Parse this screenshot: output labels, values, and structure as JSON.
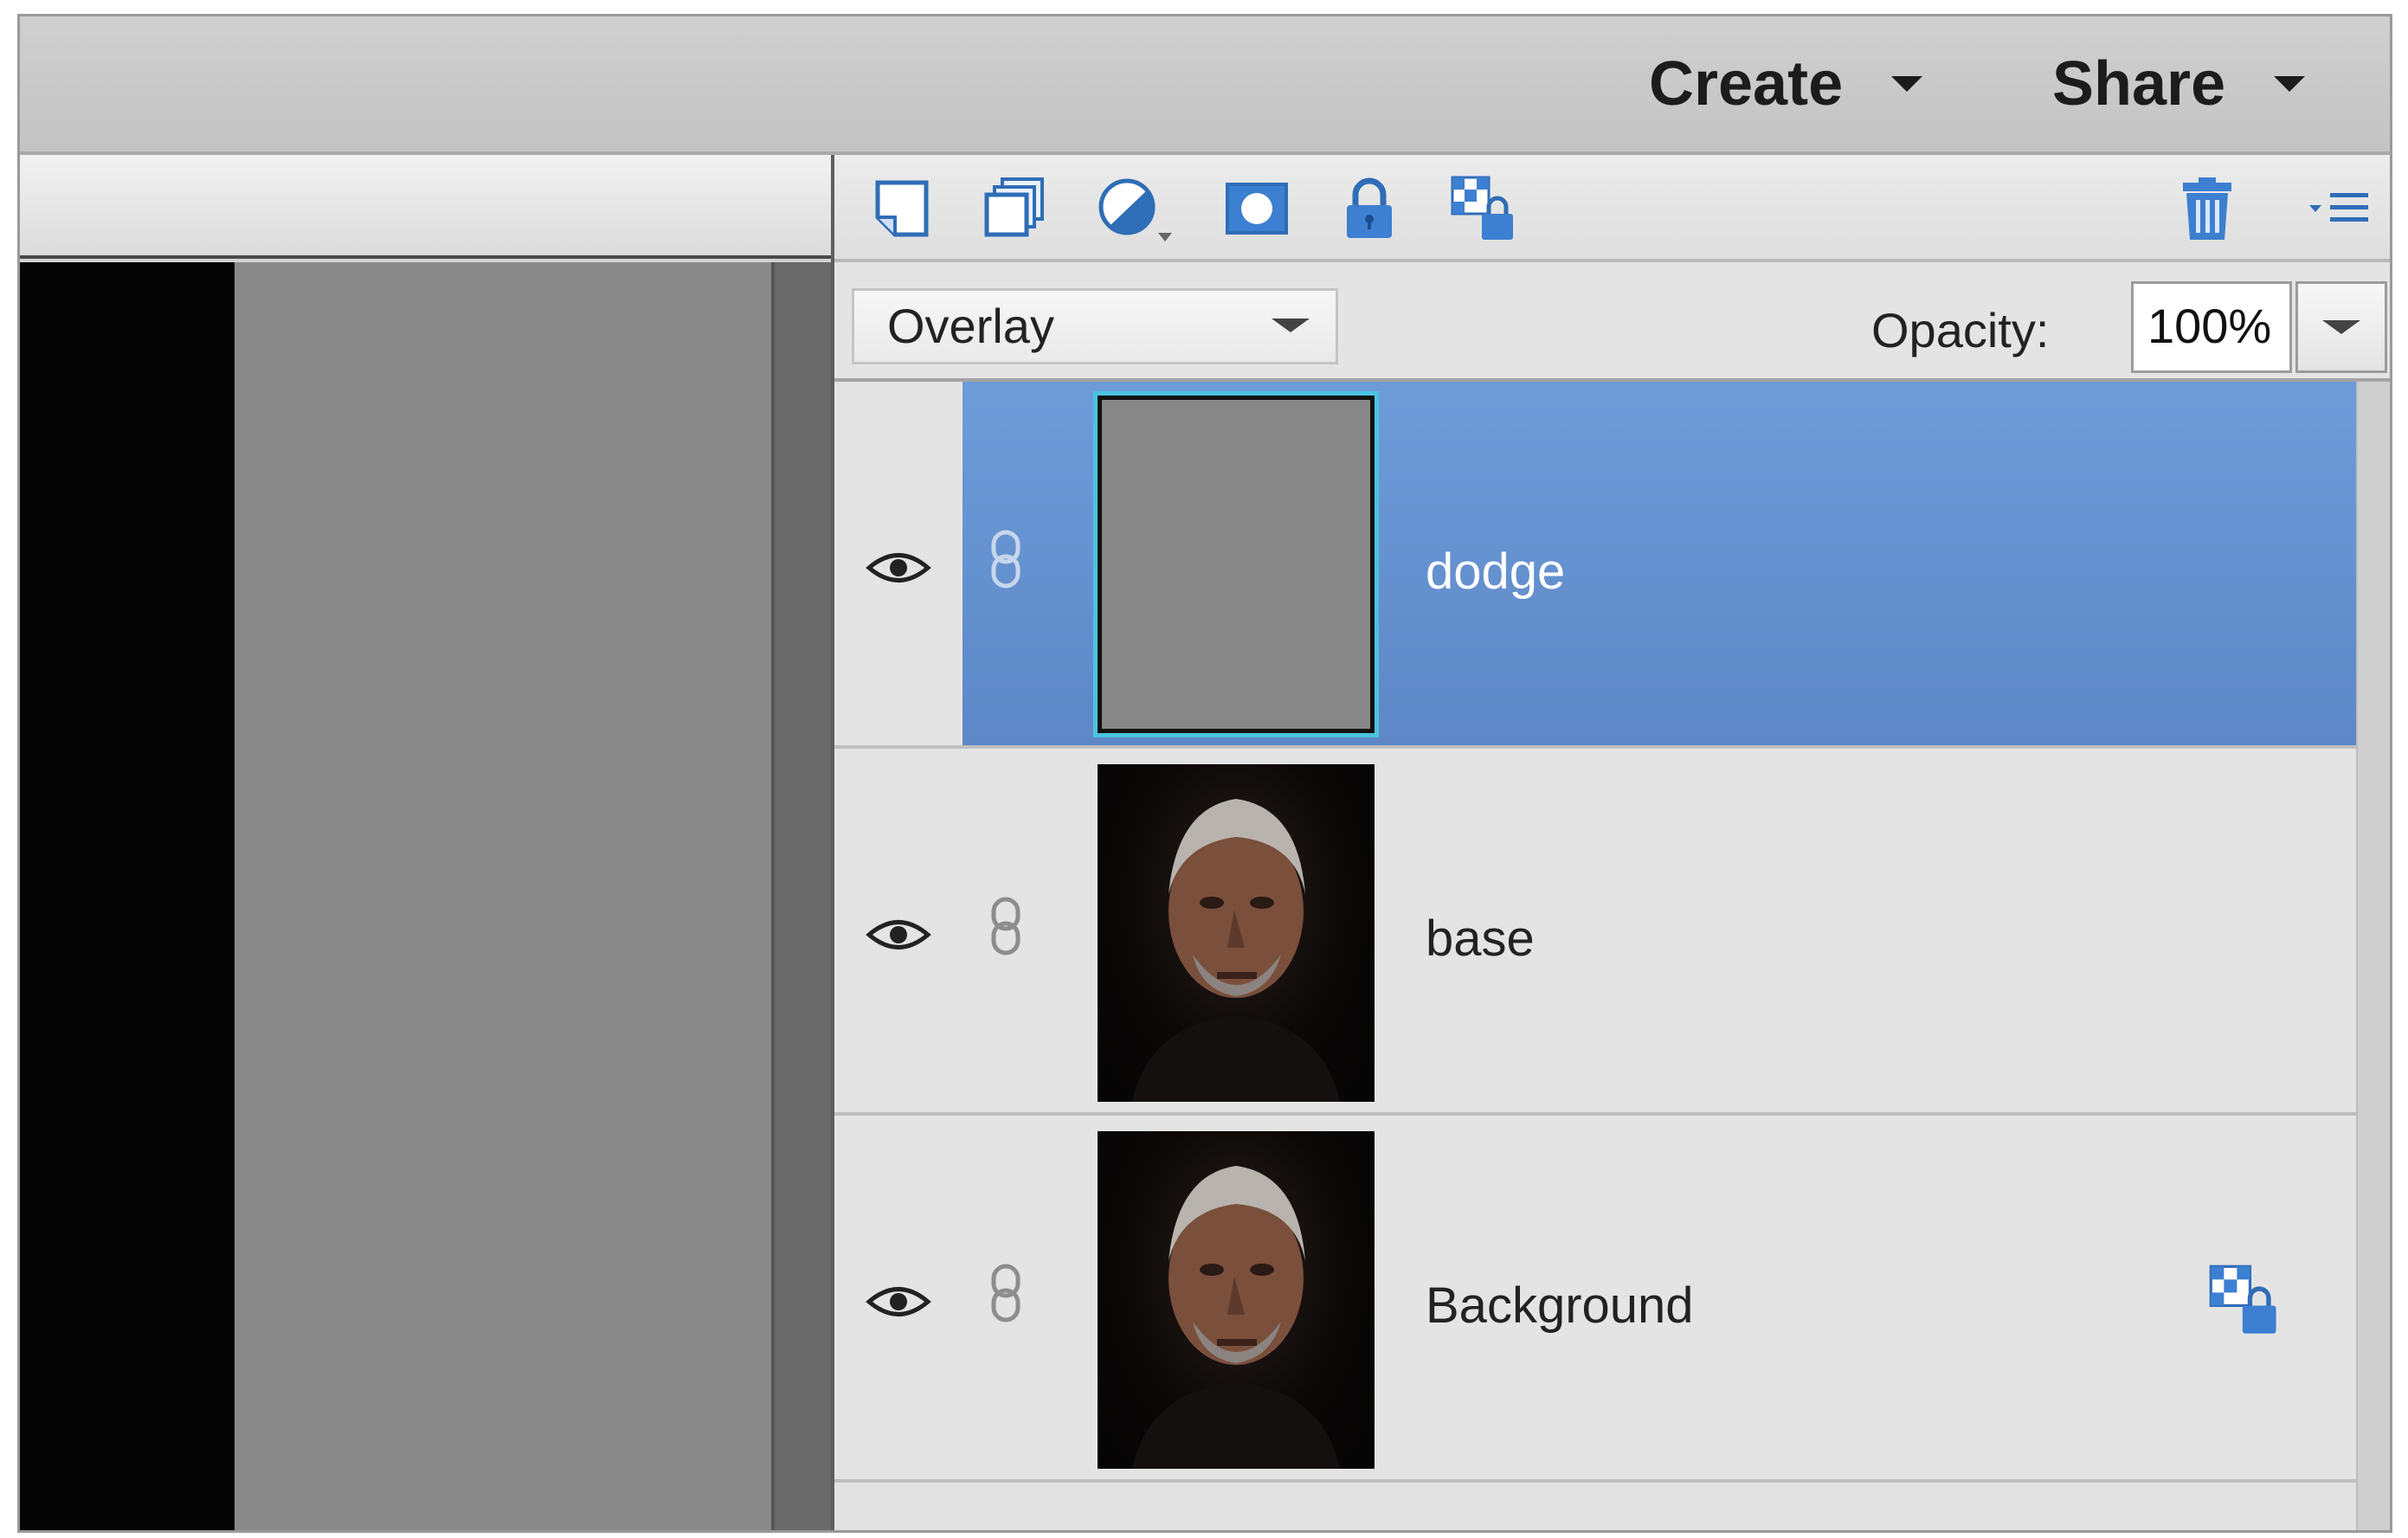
{
  "topbar": {
    "create_label": "Create",
    "share_label": "Share"
  },
  "toolbar": {
    "icons": [
      "new-layer-icon",
      "new-group-icon",
      "adjustment-layer-icon",
      "layer-mask-icon",
      "lock-all-icon",
      "lock-transparency-icon",
      "delete-layer-icon",
      "panel-menu-icon"
    ]
  },
  "blend": {
    "mode": "Overlay",
    "opacity_label": "Opacity:",
    "opacity_value": "100%"
  },
  "layers": [
    {
      "name": "dodge",
      "selected": true,
      "thumbnail": "gray-fill"
    },
    {
      "name": "base",
      "selected": false,
      "thumbnail": "portrait-photo"
    },
    {
      "name": "Background",
      "selected": false,
      "thumbnail": "portrait-photo",
      "locked": true
    }
  ],
  "colors": {
    "selection": "#6d9cd9",
    "thumb_highlight": "#4cc3e0",
    "icon_blue": "#2f6db6"
  }
}
